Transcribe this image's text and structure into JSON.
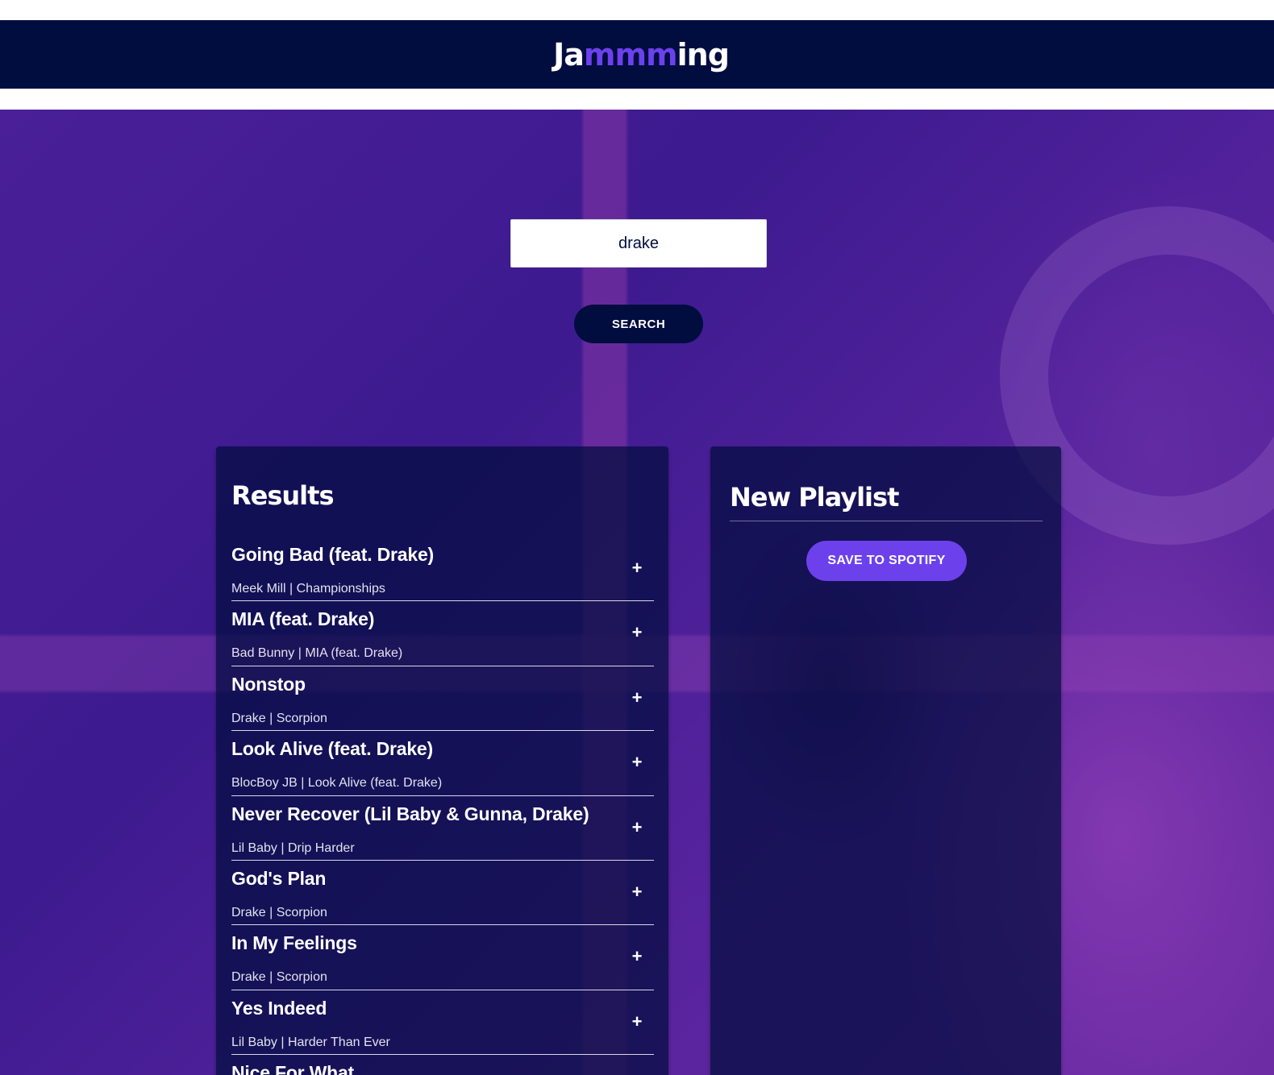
{
  "app": {
    "logo_prefix": "Ja",
    "logo_highlight": "mmm",
    "logo_suffix": "ing",
    "brand_color": "#010c3f",
    "accent_color": "#6c41ec"
  },
  "search": {
    "value": "drake",
    "button_label": "SEARCH"
  },
  "results": {
    "title": "Results",
    "tracks": [
      {
        "name": "Going Bad (feat. Drake)",
        "info": "Meek Mill | Championships",
        "action": "+"
      },
      {
        "name": "MIA (feat. Drake)",
        "info": "Bad Bunny | MIA (feat. Drake)",
        "action": "+"
      },
      {
        "name": "Nonstop",
        "info": "Drake | Scorpion",
        "action": "+"
      },
      {
        "name": "Look Alive (feat. Drake)",
        "info": "BlocBoy JB | Look Alive (feat. Drake)",
        "action": "+"
      },
      {
        "name": "Never Recover (Lil Baby & Gunna, Drake)",
        "info": "Lil Baby | Drip Harder",
        "action": "+"
      },
      {
        "name": "God's Plan",
        "info": "Drake | Scorpion",
        "action": "+"
      },
      {
        "name": "In My Feelings",
        "info": "Drake | Scorpion",
        "action": "+"
      },
      {
        "name": "Yes Indeed",
        "info": "Lil Baby | Harder Than Ever",
        "action": "+"
      },
      {
        "name": "Nice For What",
        "info": "",
        "action": ""
      }
    ]
  },
  "playlist": {
    "title": "New Playlist",
    "save_label": "SAVE TO SPOTIFY"
  }
}
